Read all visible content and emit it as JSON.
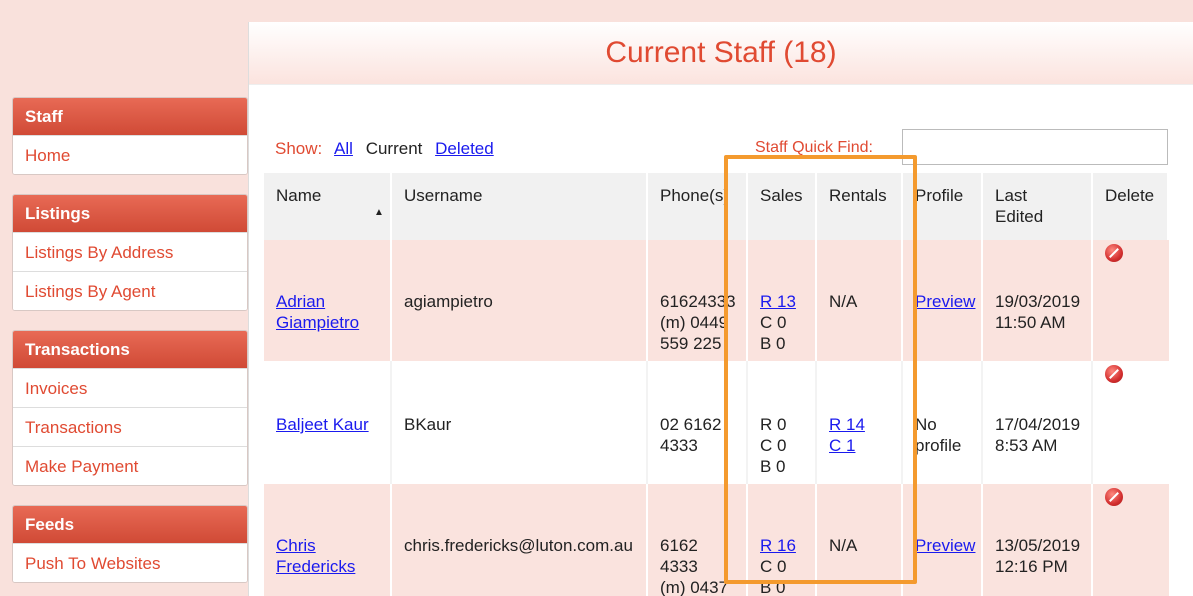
{
  "title": "Current Staff (18)",
  "sidebar": [
    {
      "header": "Staff",
      "items": [
        "Home"
      ]
    },
    {
      "header": "Listings",
      "items": [
        "Listings By Address",
        "Listings By Agent"
      ]
    },
    {
      "header": "Transactions",
      "items": [
        "Invoices",
        "Transactions",
        "Make Payment"
      ]
    },
    {
      "header": "Feeds",
      "items": [
        "Push To Websites"
      ]
    }
  ],
  "filters": {
    "label": "Show:",
    "all": "All",
    "current": "Current",
    "deleted": "Deleted"
  },
  "quickfind": {
    "label": "Staff Quick Find:",
    "value": ""
  },
  "columns": {
    "name": "Name",
    "username": "Username",
    "phone": "Phone(s)",
    "sales": "Sales",
    "rentals": "Rentals",
    "profile": "Profile",
    "last_edited_1": "Last",
    "last_edited_2": "Edited",
    "delete": "Delete"
  },
  "rows": [
    {
      "name1": "Adrian",
      "name2": "Giampietro",
      "username": "agiampietro",
      "phone1": "61624333",
      "phone2": "(m) 0449",
      "phone3": "559 225",
      "sales": [
        "R 13",
        "C 0",
        "B 0"
      ],
      "rentals": [
        "N/A"
      ],
      "profile": [
        "Preview"
      ],
      "edited1": "19/03/2019",
      "edited2": "11:50 AM"
    },
    {
      "name1": "Baljeet Kaur",
      "name2": "",
      "username": "BKaur",
      "phone1": "02 6162",
      "phone2": "4333",
      "phone3": "",
      "sales": [
        "R 0",
        "C 0",
        "B 0"
      ],
      "rentals": [
        "R 14",
        "C 1"
      ],
      "profile": [
        "No",
        "profile"
      ],
      "edited1": "17/04/2019",
      "edited2": "8:53 AM"
    },
    {
      "name1": "Chris",
      "name2": "Fredericks",
      "username": "chris.fredericks@luton.com.au",
      "phone1": "6162",
      "phone2": "4333",
      "phone3": "(m) 0437",
      "sales": [
        "R 16",
        "C 0",
        "B 0"
      ],
      "rentals": [
        "N/A"
      ],
      "profile": [
        "Preview"
      ],
      "edited1": "13/05/2019",
      "edited2": "12:16 PM"
    }
  ]
}
